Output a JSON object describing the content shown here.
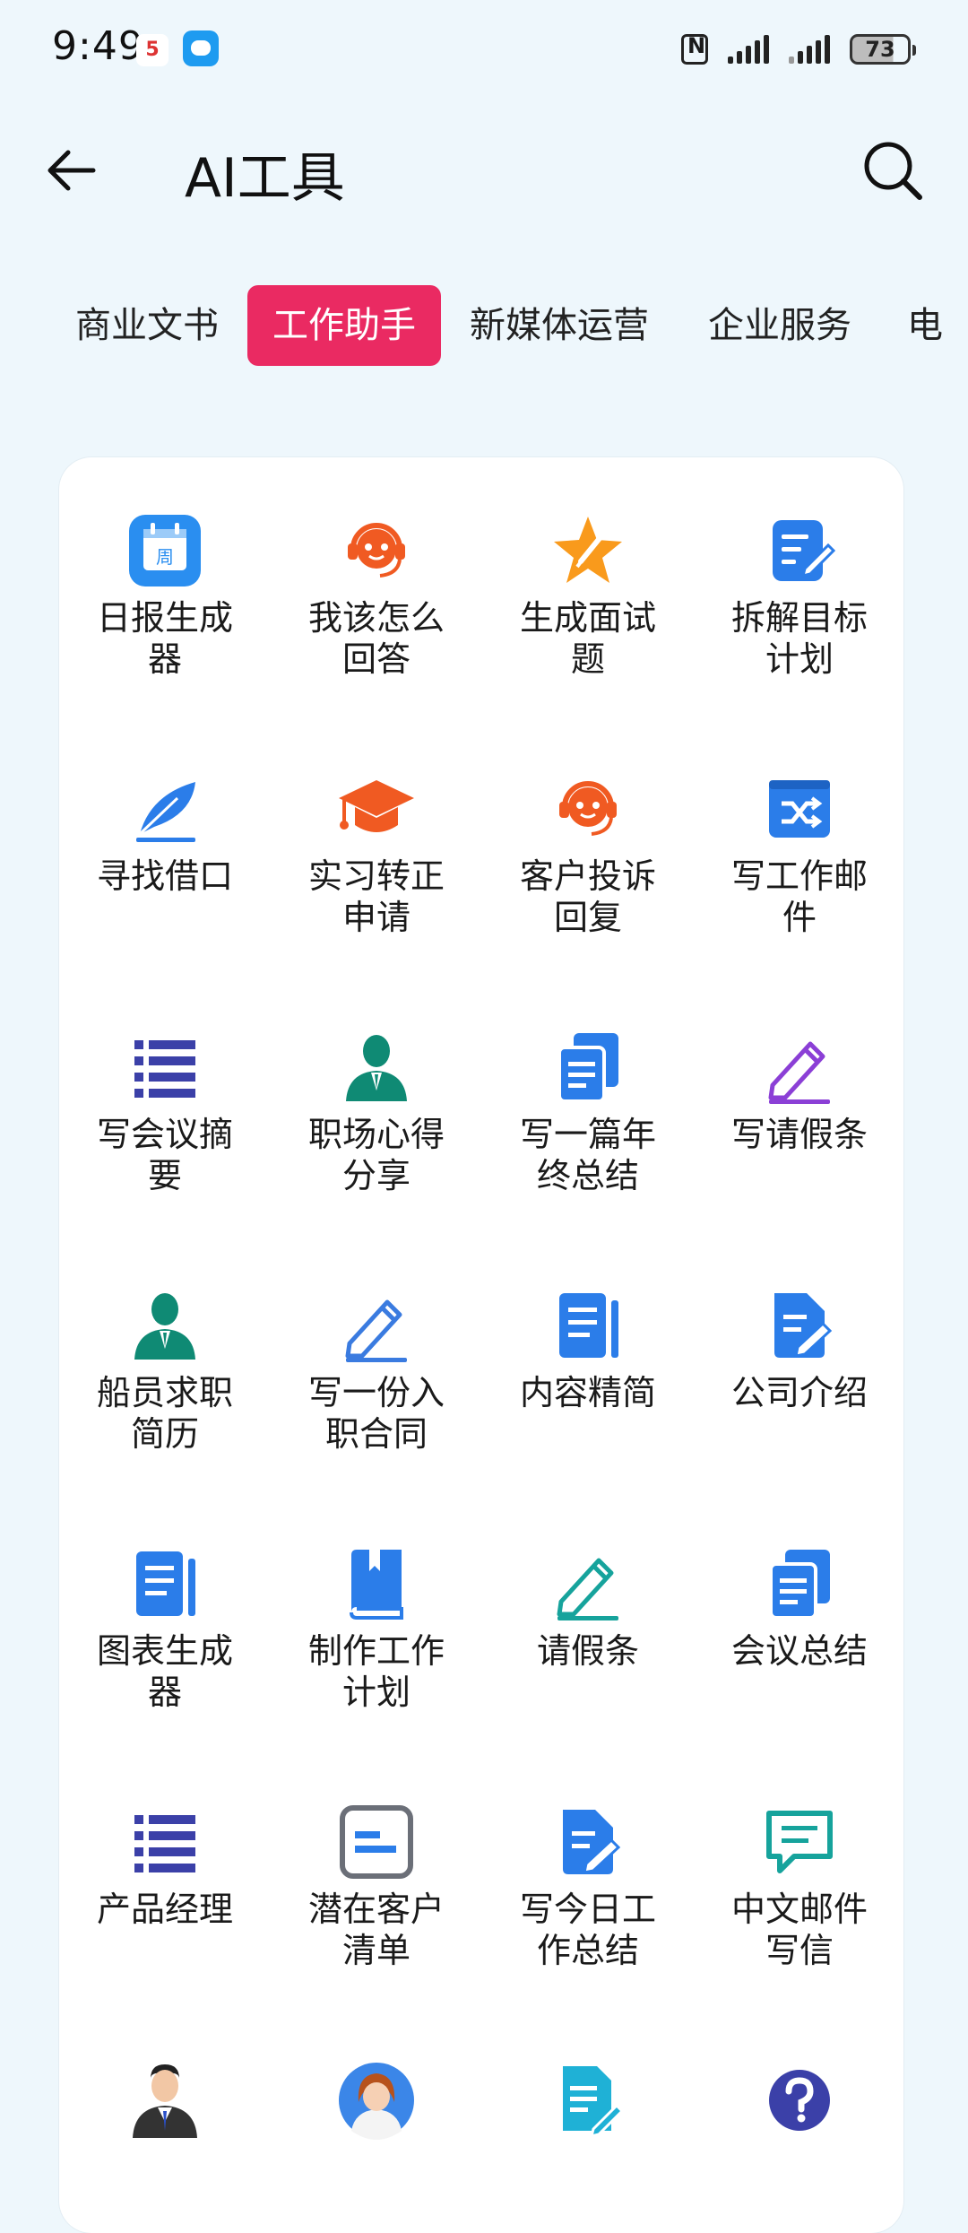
{
  "status_bar": {
    "time": "9:49",
    "app1_icon": "carrier-app-icon",
    "app1_text": "5",
    "app2_icon": "message-bubble-icon",
    "battery": "73"
  },
  "header": {
    "title": "AI工具",
    "back_icon": "arrow-left-icon",
    "search_icon": "search-icon"
  },
  "tabs": [
    {
      "label": "商业文书",
      "active": false
    },
    {
      "label": "工作助手",
      "active": true
    },
    {
      "label": "新媒体运营",
      "active": false
    },
    {
      "label": "企业服务",
      "active": false
    },
    {
      "label": "电",
      "active": false
    }
  ],
  "colors": {
    "accent": "#ea2a62",
    "background": "#eef7fc",
    "card": "#ffffff",
    "blue": "#2b7de9",
    "orange": "#f05a22",
    "teal": "#0f8a74",
    "indigo": "#3b40a8"
  },
  "tools": [
    {
      "label": "日报生成器",
      "icon": "weekly-calendar-icon"
    },
    {
      "label": "我该怎么回答",
      "icon": "headset-support-icon"
    },
    {
      "label": "生成面试题",
      "icon": "star-pen-icon"
    },
    {
      "label": "拆解目标计划",
      "icon": "doc-edit-icon"
    },
    {
      "label": "寻找借口",
      "icon": "feather-quill-icon"
    },
    {
      "label": "实习转正申请",
      "icon": "graduation-cap-icon"
    },
    {
      "label": "客户投诉回复",
      "icon": "headset-support-icon"
    },
    {
      "label": "写工作邮件",
      "icon": "shuffle-box-icon"
    },
    {
      "label": "写会议摘要",
      "icon": "list-icon"
    },
    {
      "label": "职场心得分享",
      "icon": "person-tie-icon"
    },
    {
      "label": "写一篇年终总结",
      "icon": "copy-docs-icon"
    },
    {
      "label": "写请假条",
      "icon": "pencil-icon"
    },
    {
      "label": "船员求职简历",
      "icon": "person-tie-icon"
    },
    {
      "label": "写一份入职合同",
      "icon": "pencil-icon"
    },
    {
      "label": "内容精简",
      "icon": "document-lines-icon"
    },
    {
      "label": "公司介绍",
      "icon": "doc-pen-icon"
    },
    {
      "label": "图表生成器",
      "icon": "document-lines-icon"
    },
    {
      "label": "制作工作计划",
      "icon": "book-icon"
    },
    {
      "label": "请假条",
      "icon": "pencil-icon"
    },
    {
      "label": "会议总结",
      "icon": "copy-docs-icon"
    },
    {
      "label": "产品经理",
      "icon": "list-icon"
    },
    {
      "label": "潜在客户清单",
      "icon": "frame-lines-icon"
    },
    {
      "label": "写今日工作总结",
      "icon": "doc-pen-icon"
    },
    {
      "label": "中文邮件写信",
      "icon": "chat-lines-icon"
    },
    {
      "label": "",
      "icon": "businessman-avatar-icon"
    },
    {
      "label": "",
      "icon": "woman-avatar-icon"
    },
    {
      "label": "",
      "icon": "doc-write-icon"
    },
    {
      "label": "",
      "icon": "question-circle-icon"
    }
  ]
}
